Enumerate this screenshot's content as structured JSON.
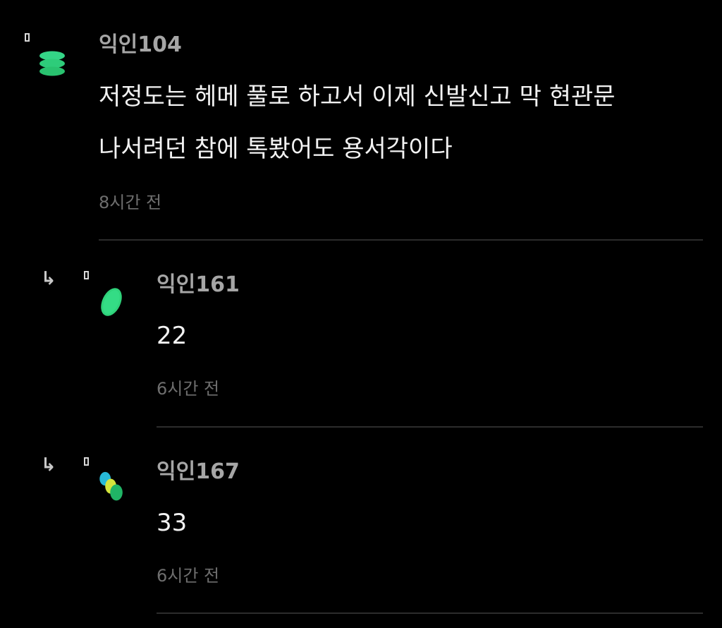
{
  "comments": [
    {
      "author": "익인104",
      "lines": [
        "저정도는 헤메 풀로 하고서 이제 신발신고 막 현관문",
        "나서려던 참에 톡봤어도 용서각이다"
      ],
      "time": "8시간 전",
      "is_reply": false,
      "avatar_icon": "green-stacked-ovals-icon"
    },
    {
      "author": "익인161",
      "lines": [
        "22"
      ],
      "time": "6시간 전",
      "is_reply": true,
      "reply_icon": "reply-arrow-icon",
      "avatar_icon": "green-oval-icon"
    },
    {
      "author": "익인167",
      "lines": [
        "33"
      ],
      "time": "6시간 전",
      "is_reply": true,
      "reply_icon": "reply-arrow-icon",
      "avatar_icon": "blue-yellow-green-circles-icon"
    }
  ],
  "colors": {
    "background": "#000000",
    "nickname": "#a6a6a6",
    "body_text": "#f2f2f2",
    "timestamp": "#6e6e6e",
    "divider": "#2c2c2c",
    "avatar_green": "#2fd27a",
    "avatar_blue": "#27b9d8",
    "avatar_yellow": "#d4e53c"
  }
}
